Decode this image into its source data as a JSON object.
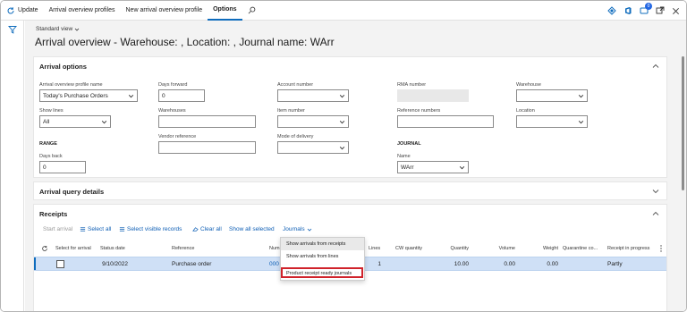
{
  "actionbar": {
    "update_label": "Update",
    "tab_arrival_profiles": "Arrival overview profiles",
    "tab_new_profile": "New arrival overview profile",
    "tab_options": "Options",
    "notification_count": "0"
  },
  "page": {
    "view_selector": "Standard view",
    "title": "Arrival overview - Warehouse: , Location: , Journal name: WArr"
  },
  "arrival_options": {
    "header": "Arrival options",
    "profile_name_label": "Arrival overview profile name",
    "profile_name_value": "Today's Purchase Orders",
    "days_forward_label": "Days forward",
    "days_forward_value": "0",
    "account_number_label": "Account number",
    "account_number_value": "",
    "rma_number_label": "RMA number",
    "rma_number_value": "",
    "warehouse_label": "Warehouse",
    "warehouse_value": "",
    "show_lines_label": "Show lines",
    "show_lines_value": "All",
    "warehouses_label": "Warehouses",
    "warehouses_value": "",
    "item_number_label": "Item number",
    "item_number_value": "",
    "reference_numbers_label": "Reference numbers",
    "reference_numbers_value": "",
    "location_label": "Location",
    "location_value": "",
    "range_header": "RANGE",
    "vendor_reference_label": "Vendor reference",
    "vendor_reference_value": "",
    "mode_of_delivery_label": "Mode of delivery",
    "mode_of_delivery_value": "",
    "journal_header": "JOURNAL",
    "days_back_label": "Days back",
    "days_back_value": "0",
    "journal_name_label": "Name",
    "journal_name_value": "WArr"
  },
  "query_details": {
    "header": "Arrival query details"
  },
  "receipts": {
    "header": "Receipts",
    "toolbar": {
      "start_arrival": "Start arrival",
      "select_all": "Select all",
      "select_visible": "Select visible records",
      "clear_all": "Clear all",
      "show_all_selected": "Show all selected",
      "journals": "Journals"
    },
    "columns": {
      "select": "Select for arrival",
      "status_date": "Status date",
      "reference": "Reference",
      "number": "Num",
      "lines": "Lines",
      "cw_quantity": "CW quantity",
      "quantity": "Quantity",
      "volume": "Volume",
      "weight": "Weight",
      "quarantine": "Quarantine co...",
      "receipt_in_progress": "Receipt in progress"
    },
    "rows": [
      {
        "status_date": "9/10/2022",
        "reference": "Purchase order",
        "number": "000",
        "lines": "1",
        "cw_quantity": "",
        "quantity": "10.00",
        "volume": "0.00",
        "weight": "0.00",
        "quarantine": "",
        "receipt_in_progress": "Partly"
      }
    ]
  },
  "journals_menu": {
    "items": [
      "Show arrivals from receipts",
      "Show arrivals from lines",
      "Product receipt ready journals"
    ]
  },
  "colors": {
    "accent": "#0f6cbd",
    "row_selected": "#cfe0f6",
    "highlight_outline": "#d0232b"
  }
}
